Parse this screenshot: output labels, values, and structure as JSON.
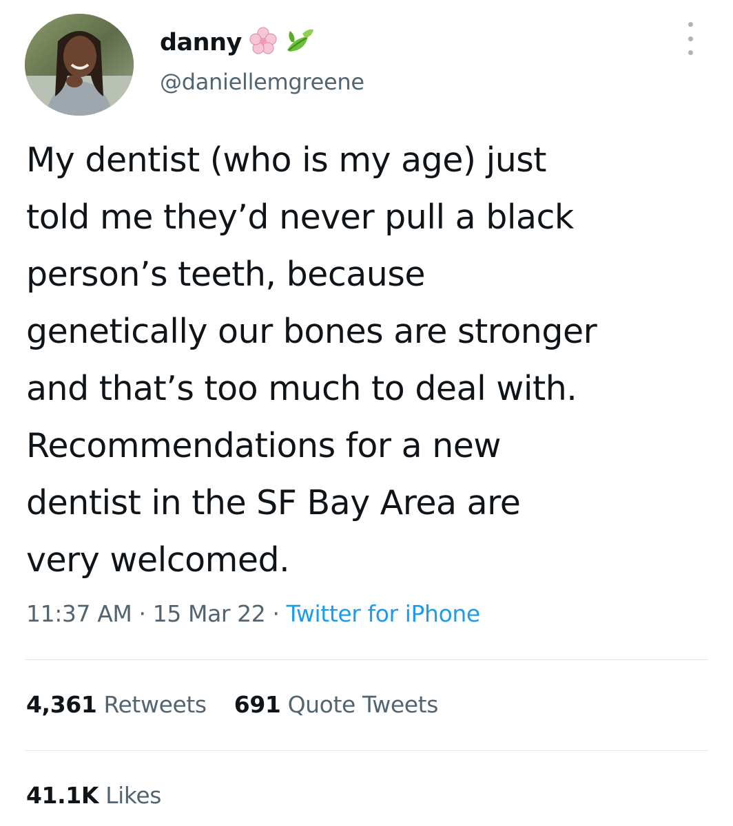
{
  "author": {
    "display_name": "danny",
    "handle": "@daniellemgreene",
    "name_emojis": [
      "cherry-blossom-icon",
      "leaves-icon"
    ]
  },
  "tweet": {
    "text_lines": [
      "My dentist (who is my age) just",
      "told me they’d never pull a black",
      "person’s teeth, because",
      "genetically our bones are stronger",
      "and that’s too much to deal with.",
      "Recommendations for a new",
      "dentist in the SF Bay Area are",
      "very welcomed."
    ],
    "time": "11:37 AM",
    "date": "15 Mar 22",
    "separator": "·",
    "source": "Twitter for iPhone"
  },
  "stats": {
    "retweets_count": "4,361",
    "retweets_label": "Retweets",
    "quotes_count": "691",
    "quotes_label": "Quote Tweets",
    "likes_count": "41.1K",
    "likes_label": "Likes"
  },
  "colors": {
    "text": "#0f1419",
    "secondary": "#536471",
    "link": "#1d9bf0",
    "divider": "#e3e7ea"
  }
}
